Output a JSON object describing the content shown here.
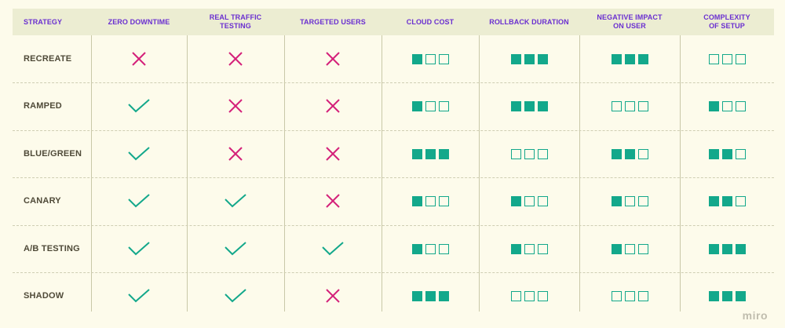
{
  "colors": {
    "background": "#fdfbeb",
    "header_bg": "#ecedd2",
    "header_text": "#6a2fd0",
    "yes": "#13a88b",
    "no": "#d4217a",
    "row_label": "#4f4a38"
  },
  "headers": [
    "STRATEGY",
    "ZERO DOWNTIME",
    "REAL TRAFFIC\nTESTING",
    "TARGETED USERS",
    "CLOUD COST",
    "ROLLBACK DURATION",
    "NEGATIVE IMPACT\nON USER",
    "COMPLEXITY\nOF SETUP"
  ],
  "rows": [
    {
      "name": "RECREATE",
      "zero_downtime": "cross",
      "real_traffic": "cross",
      "targeted_users": "cross",
      "cloud_cost": 1,
      "rollback": 3,
      "negative_impact": 3,
      "complexity": 0
    },
    {
      "name": "RAMPED",
      "zero_downtime": "check",
      "real_traffic": "cross",
      "targeted_users": "cross",
      "cloud_cost": 1,
      "rollback": 3,
      "negative_impact": 0,
      "complexity": 1
    },
    {
      "name": "BLUE/GREEN",
      "zero_downtime": "check",
      "real_traffic": "cross",
      "targeted_users": "cross",
      "cloud_cost": 3,
      "rollback": 0,
      "negative_impact": 2,
      "complexity": 2
    },
    {
      "name": "CANARY",
      "zero_downtime": "check",
      "real_traffic": "check",
      "targeted_users": "cross",
      "cloud_cost": 1,
      "rollback": 1,
      "negative_impact": 1,
      "complexity": 2
    },
    {
      "name": "A/B TESTING",
      "zero_downtime": "check",
      "real_traffic": "check",
      "targeted_users": "check",
      "cloud_cost": 1,
      "rollback": 1,
      "negative_impact": 1,
      "complexity": 3
    },
    {
      "name": "SHADOW",
      "zero_downtime": "check",
      "real_traffic": "check",
      "targeted_users": "cross",
      "cloud_cost": 3,
      "rollback": 0,
      "negative_impact": 0,
      "complexity": 3
    }
  ],
  "icons": {
    "check": "check-icon",
    "cross": "cross-icon",
    "filled": "filled-square-icon",
    "empty": "empty-square-icon"
  },
  "brand": "miro"
}
